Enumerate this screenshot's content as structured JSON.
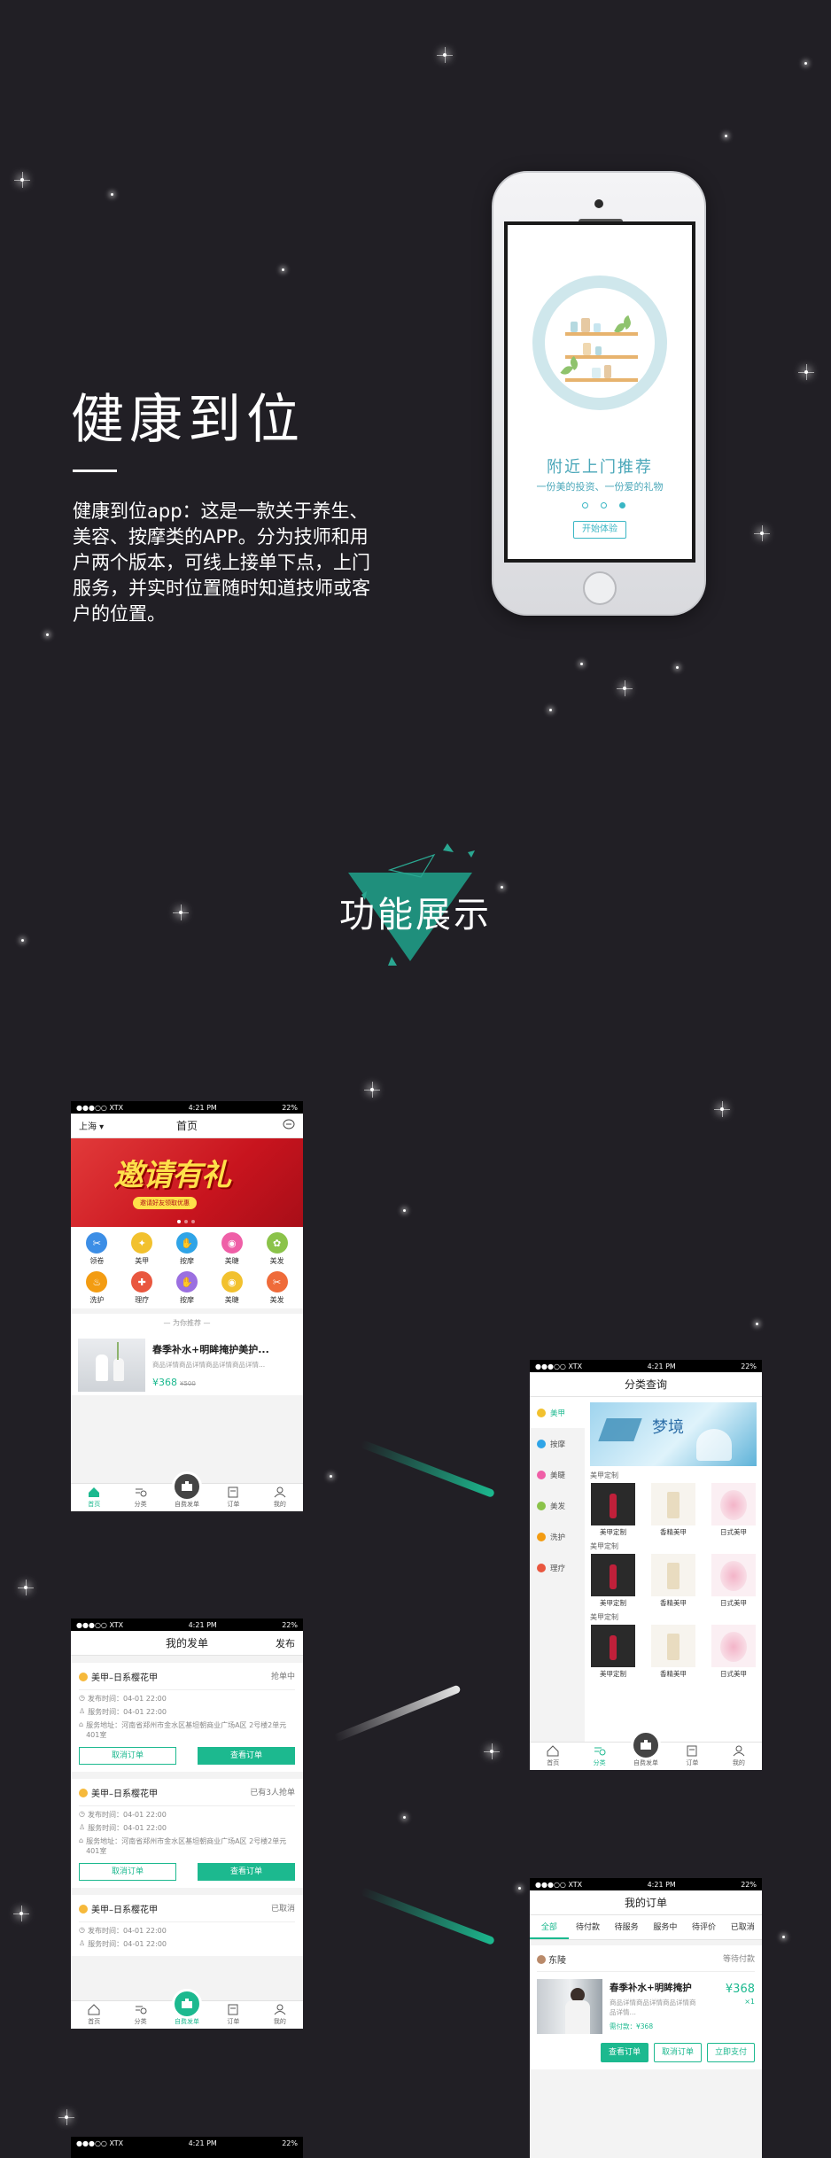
{
  "intro": {
    "title": "健康到位",
    "description": "健康到位app：这是一款关于养生、美容、按摩类的APP。分为技师和用户两个版本，可线上接单下点，上门服务，并实时位置随时知道技师或客户的位置。"
  },
  "hero_phone": {
    "headline": "附近上门推荐",
    "subline": "一份美的投资、一份爱的礼物",
    "button": "开始体验"
  },
  "section": {
    "title": "功能展示"
  },
  "status_bar": {
    "carrier": "●●●○○ XTX",
    "time": "4:21 PM",
    "battery": "22%"
  },
  "tabbar": {
    "home": "首页",
    "category": "分类",
    "fab": "自费发单",
    "orders": "订单",
    "mine": "我的"
  },
  "home": {
    "city": "上海",
    "title": "首页",
    "banner_title": "邀请有礼",
    "banner_sub": "邀请好友领取优惠",
    "categories": [
      {
        "label": "领卷",
        "color": "#3c8ee6"
      },
      {
        "label": "美甲",
        "color": "#f2c12e"
      },
      {
        "label": "按摩",
        "color": "#2fa4e7"
      },
      {
        "label": "美睫",
        "color": "#ef5fa7"
      },
      {
        "label": "美发",
        "color": "#8bc34a"
      },
      {
        "label": "洗护",
        "color": "#f39c12"
      },
      {
        "label": "理疗",
        "color": "#e9573f"
      },
      {
        "label": "按摩",
        "color": "#9b6fe0"
      },
      {
        "label": "美睫",
        "color": "#f2c12e"
      },
      {
        "label": "美发",
        "color": "#ef6b3a"
      }
    ],
    "rec_header": "— 为你推荐 —",
    "item": {
      "title": "春季补水+明眸掩护美护...",
      "desc": "商品详情商品详情商品详情商品详情...",
      "price": "¥368",
      "old_price": "¥500"
    }
  },
  "category": {
    "title": "分类查询",
    "side": [
      {
        "label": "美甲",
        "color": "#f2c12e"
      },
      {
        "label": "按摩",
        "color": "#2fa4e7"
      },
      {
        "label": "美睫",
        "color": "#ef5fa7"
      },
      {
        "label": "美发",
        "color": "#8bc34a"
      },
      {
        "label": "洗护",
        "color": "#f39c12"
      },
      {
        "label": "理疗",
        "color": "#e9573f"
      }
    ],
    "banner_text": "梦境",
    "groups": [
      {
        "header": "美甲定制",
        "items": [
          "美甲定制",
          "香精美甲",
          "日式美甲"
        ]
      },
      {
        "header": "美甲定制",
        "items": [
          "美甲定制",
          "香精美甲",
          "日式美甲"
        ]
      },
      {
        "header": "美甲定制",
        "items": [
          "美甲定制",
          "香精美甲",
          "日式美甲"
        ]
      }
    ]
  },
  "my_posts": {
    "title": "我的发单",
    "action": "发布",
    "orders": [
      {
        "name": "美甲–日系樱花甲",
        "status": "抢单中",
        "post_time": "发布时间：04-01 22:00",
        "service_time": "服务时间：04-01 22:00",
        "address": "服务地址：河南省郑州市金水区基坦朝商业广场A区 2号楼2单元401室",
        "cancel": "取消订单",
        "view": "查看订单"
      },
      {
        "name": "美甲–日系樱花甲",
        "status": "已有3人抢单",
        "post_time": "发布时间：04-01 22:00",
        "service_time": "服务时间：04-01 22:00",
        "address": "服务地址：河南省郑州市金水区基坦朝商业广场A区 2号楼2单元401室",
        "cancel": "取消订单",
        "view": "查看订单"
      },
      {
        "name": "美甲–日系樱花甲",
        "status": "已取消",
        "post_time": "发布时间：04-01 22:00",
        "service_time": "服务时间：04-01 22:00"
      }
    ]
  },
  "my_orders": {
    "title": "我的订单",
    "tabs": [
      "全部",
      "待付款",
      "待服务",
      "服务中",
      "待评价",
      "已取消"
    ],
    "shop": "东陵",
    "status": "等待付款",
    "item": {
      "title": "春季补水+明眸掩护",
      "desc": "商品详情商品详情商品详情商品详情…",
      "qty_label": "需付款：¥368",
      "price": "¥368",
      "qty": "×1"
    },
    "buttons": {
      "view": "查看订单",
      "cancel": "取消订单",
      "pay": "立即支付"
    }
  },
  "colors": {
    "accent": "#1cb98f",
    "background": "#211f25"
  }
}
